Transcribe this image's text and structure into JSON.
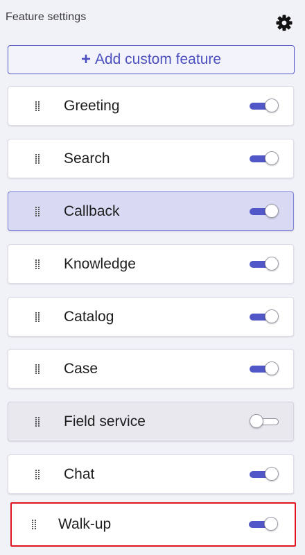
{
  "header": {
    "title": "Feature settings",
    "settings_icon": "gear-icon"
  },
  "add_button": {
    "icon": "plus-icon",
    "label": "Add custom feature"
  },
  "colors": {
    "accent": "#5257c8",
    "selected_row": "#d8daf3",
    "highlight_border": "#e0141e"
  },
  "features": [
    {
      "label": "Greeting",
      "enabled": true
    },
    {
      "label": "Search",
      "enabled": true
    },
    {
      "label": "Callback",
      "enabled": true,
      "selected": true
    },
    {
      "label": "Knowledge",
      "enabled": true
    },
    {
      "label": "Catalog",
      "enabled": true
    },
    {
      "label": "Case",
      "enabled": true
    },
    {
      "label": "Field service",
      "enabled": false
    },
    {
      "label": "Chat",
      "enabled": true
    },
    {
      "label": "Walk-up",
      "enabled": true,
      "highlighted": true
    }
  ]
}
